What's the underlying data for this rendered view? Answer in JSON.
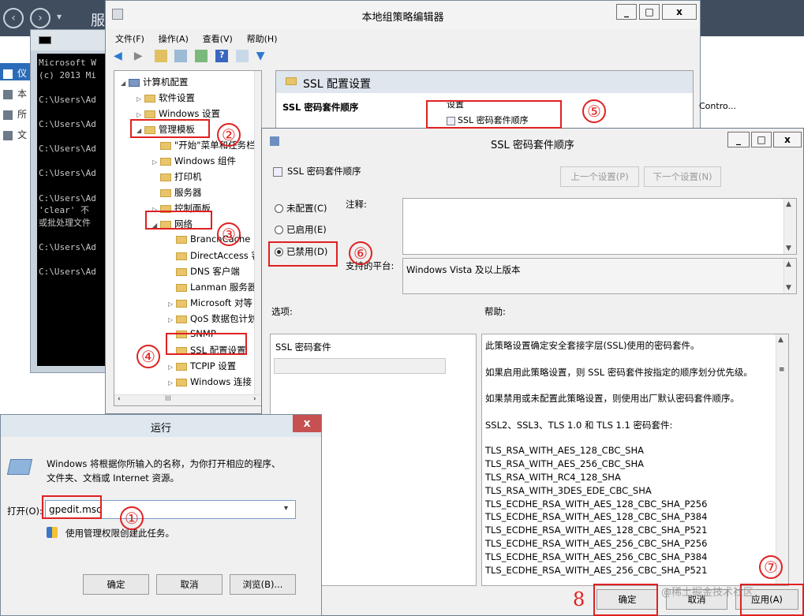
{
  "server_manager": {
    "title": "服",
    "side_items": [
      "仪",
      "本",
      "所",
      "文"
    ]
  },
  "cmd": {
    "lines": [
      "Microsoft W",
      "(c) 2013 Mi",
      "",
      "C:\\Users\\Ad",
      "",
      "C:\\Users\\Ad",
      "",
      "C:\\Users\\Ad",
      "",
      "C:\\Users\\Ad",
      "",
      "C:\\Users\\Ad",
      "'clear' 不",
      "或批处理文件",
      "",
      "C:\\Users\\Ad",
      "",
      "C:\\Users\\Ad"
    ]
  },
  "gpedit": {
    "title": "本地组策略编辑器",
    "menu": [
      "文件(F)",
      "操作(A)",
      "查看(V)",
      "帮助(H)"
    ],
    "tree": {
      "root": "计算机配置",
      "software": "软件设置",
      "windows": "Windows 设置",
      "admin": "管理模板",
      "start_menu": "\"开始\"菜单和任务栏",
      "win_components": "Windows 组件",
      "printers": "打印机",
      "servers": "服务器",
      "control_panel": "控制面板",
      "network": "网络",
      "net_items": [
        "BranchCache",
        "DirectAccess 客",
        "DNS 客户端",
        "Lanman 服务器",
        "Microsoft 对等",
        "QoS 数据包计划",
        "SNMP",
        "SSL 配置设置",
        "TCPIP 设置",
        "Windows 连接"
      ]
    },
    "right": {
      "header": "SSL 配置设置",
      "policy_title": "SSL 密码套件顺序",
      "column": "设置",
      "item": "SSL 密码套件顺序",
      "state_partial": "Contro..."
    }
  },
  "ssl_dialog": {
    "title": "SSL 密码套件顺序",
    "policy_label": "SSL 密码套件顺序",
    "prev_btn": "上一个设置(P)",
    "next_btn": "下一个设置(N)",
    "radio_not_configured": "未配置(C)",
    "radio_enabled": "已启用(E)",
    "radio_disabled": "已禁用(D)",
    "comment_label": "注释:",
    "platform_label": "支持的平台:",
    "platform_value": "Windows Vista 及以上版本",
    "options_label": "选项:",
    "help_label": "帮助:",
    "options_field": "SSL 密码套件",
    "help_lines": [
      "此策略设置确定安全套接字层(SSL)使用的密码套件。",
      "",
      "如果启用此策略设置，则 SSL 密码套件按指定的顺序划分优先级。",
      "",
      "如果禁用或未配置此策略设置，则使用出厂默认密码套件顺序。",
      "",
      "SSL2、SSL3、TLS 1.0 和 TLS 1.1 密码套件:",
      "",
      "TLS_RSA_WITH_AES_128_CBC_SHA",
      "TLS_RSA_WITH_AES_256_CBC_SHA",
      "TLS_RSA_WITH_RC4_128_SHA",
      "TLS_RSA_WITH_3DES_EDE_CBC_SHA",
      "TLS_ECDHE_RSA_WITH_AES_128_CBC_SHA_P256",
      "TLS_ECDHE_RSA_WITH_AES_128_CBC_SHA_P384",
      "TLS_ECDHE_RSA_WITH_AES_128_CBC_SHA_P521",
      "TLS_ECDHE_RSA_WITH_AES_256_CBC_SHA_P256",
      "TLS_ECDHE_RSA_WITH_AES_256_CBC_SHA_P384",
      "TLS_ECDHE_RSA_WITH_AES_256_CBC_SHA_P521"
    ],
    "ok_btn": "确定",
    "cancel_btn": "取消",
    "apply_btn": "应用(A)"
  },
  "run_dialog": {
    "title": "运行",
    "description_1": "Windows 将根据你所输入的名称，为你打开相应的程序、",
    "description_2": "文件夹、文档或 Internet 资源。",
    "open_label": "打开(O):",
    "open_value": "gpedit.msc",
    "admin_note": "使用管理权限创建此任务。",
    "ok_btn": "确定",
    "cancel_btn": "取消",
    "browse_btn": "浏览(B)..."
  },
  "annotations": [
    "①",
    "②",
    "③",
    "④",
    "⑤",
    "⑥",
    "⑦",
    "8"
  ],
  "watermark": "@稀土掘金技术社区",
  "colors": {
    "annotation_red": "#e02020",
    "title_bar": "#dfe7ef",
    "close_red": "#c75050"
  }
}
